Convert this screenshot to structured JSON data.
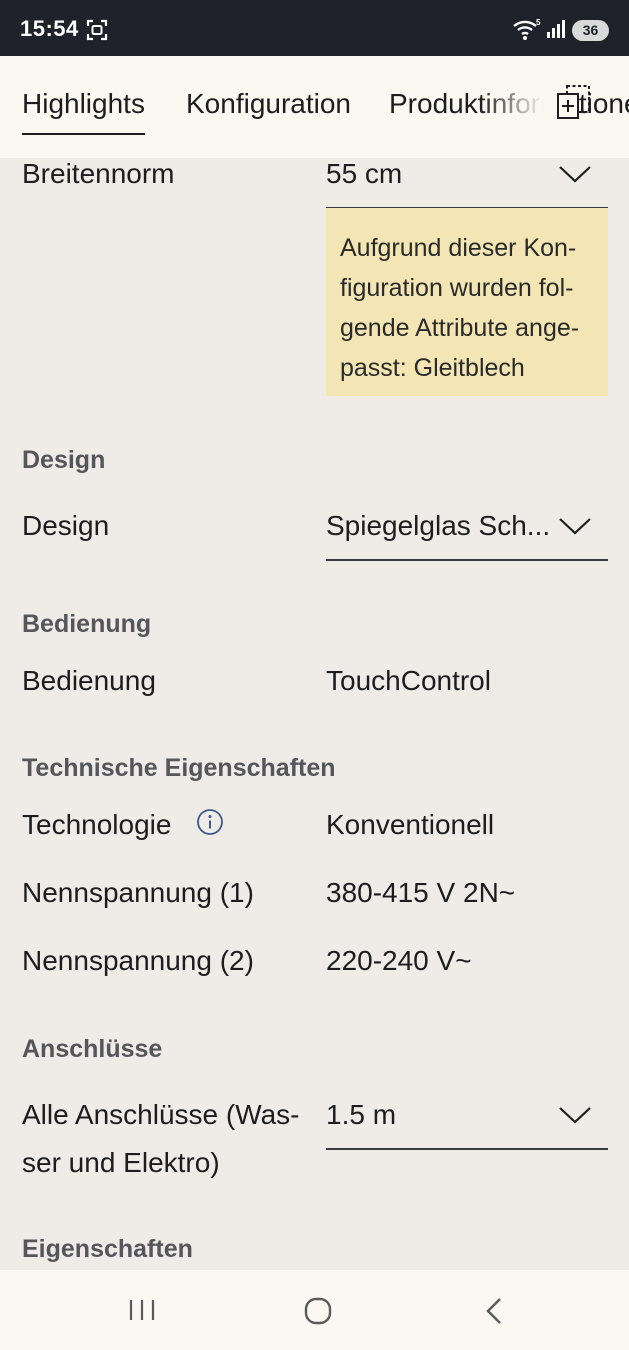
{
  "status_bar": {
    "time": "15:54",
    "battery": "36",
    "icons": [
      "screenshot-icon",
      "wifi-icon",
      "signal-icon",
      "battery-icon"
    ]
  },
  "tabs": [
    {
      "label": "Highlights",
      "active": true
    },
    {
      "label": "Konfiguration",
      "active": false
    },
    {
      "label": "Produktinformationen",
      "active": false
    }
  ],
  "breite": {
    "label": "Breitennorm",
    "value": "55 cm",
    "notice": "Aufgrund dieser Kon-figuration wurden fol-gende Attribute ange-passt: Gleitblech"
  },
  "design": {
    "section": "Design",
    "label": "Design",
    "value": "Spiegelglas Sch..."
  },
  "bedienung": {
    "section": "Bedienung",
    "label": "Bedienung",
    "value": "TouchControl"
  },
  "technik": {
    "section": "Technische Eigenschaften",
    "rows": [
      {
        "label": "Technologie",
        "value": "Konventionell"
      },
      {
        "label": "Nennspannung (1)",
        "value": "380-415 V 2N~"
      },
      {
        "label": "Nennspannung (2)",
        "value": "220-240 V~"
      }
    ]
  },
  "anschluesse": {
    "section": "Anschlüsse",
    "label_line1": "Alle Anschlüsse (Was-",
    "label_line2": "ser und Elektro)",
    "value": "1.5 m"
  },
  "eigenschaften": {
    "section": "Eigenschaften"
  },
  "colors": {
    "status_bg": "#1f222b",
    "page_bg": "#efece7",
    "header_bg": "#fbf8f2",
    "notice_bg": "#f4e6b4",
    "section_text": "#54565b"
  }
}
